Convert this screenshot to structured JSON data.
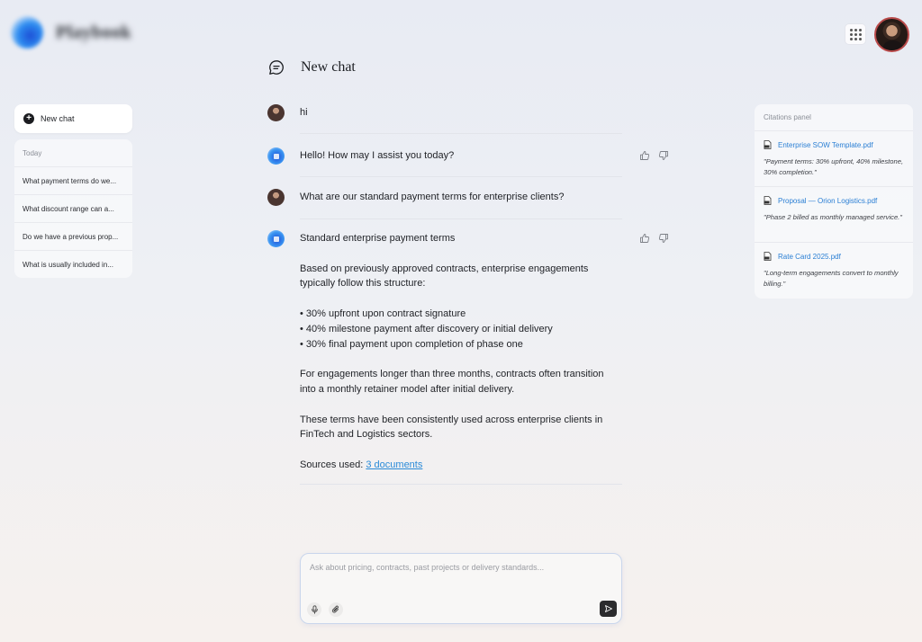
{
  "app": {
    "name": "Playbook"
  },
  "header": {
    "apps_icon": "grid-icon"
  },
  "sidebar": {
    "new_chat_label": "New chat",
    "section_label": "Today",
    "history": [
      "What payment terms do we...",
      "What discount range can a...",
      "Do we have a previous prop...",
      "What is usually included in..."
    ]
  },
  "chat": {
    "title": "New chat",
    "messages": [
      {
        "role": "user",
        "text": "hi"
      },
      {
        "role": "assistant",
        "text": "Hello! How may I assist you today?"
      },
      {
        "role": "user",
        "text": "What are our standard payment terms for enterprise clients?"
      },
      {
        "role": "assistant",
        "heading": "Standard enterprise payment terms",
        "intro": "Based on previously approved contracts, enterprise engagements typically follow this structure:",
        "bullets": [
          "• 30% upfront upon contract signature",
          "• 40% milestone payment after discovery or initial delivery",
          "• 30% final payment upon completion of phase one"
        ],
        "para2": "For engagements longer than three months, contracts often transition into a monthly retainer model after initial delivery.",
        "para3": "These terms have been consistently used across enterprise clients in FinTech and Logistics sectors.",
        "sources_label": "Sources used: ",
        "sources_link": "3 documents"
      }
    ]
  },
  "citations": {
    "title": "Citations panel",
    "items": [
      {
        "file": "Enterprise SOW Template.pdf",
        "quote": "\"Payment terms: 30% upfront, 40% milestone, 30% completion.\""
      },
      {
        "file": "Proposal — Orion Logistics.pdf",
        "quote": "\"Phase 2 billed as monthly managed service.\""
      },
      {
        "file": "Rate Card 2025.pdf",
        "quote": "\"Long-term engagements convert to monthly billing.\""
      }
    ]
  },
  "composer": {
    "placeholder": "Ask about pricing, contracts, past projects or delivery standards..."
  },
  "colors": {
    "link": "#2a8ad8",
    "accent": "#2d8df0"
  }
}
